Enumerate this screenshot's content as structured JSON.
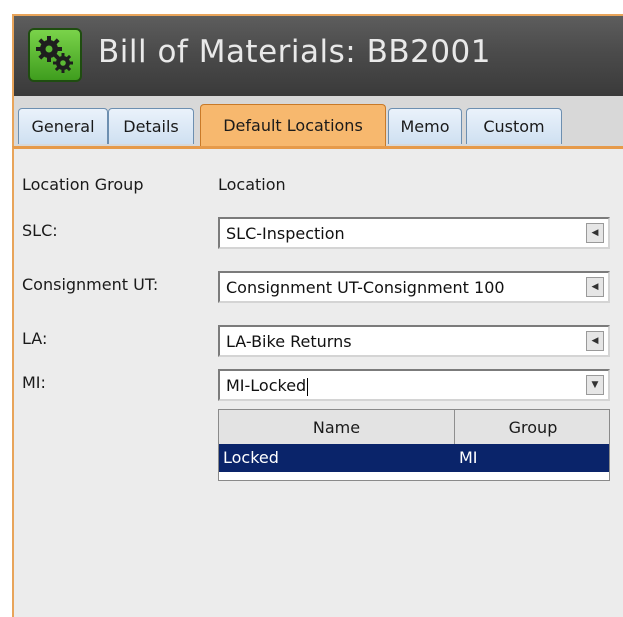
{
  "window": {
    "title": "Bill of Materials: BB2001",
    "icon": "gears-icon"
  },
  "tabs": [
    {
      "label": "General",
      "active": false
    },
    {
      "label": "Details",
      "active": false
    },
    {
      "label": "Default Locations",
      "active": true
    },
    {
      "label": "Memo",
      "active": false
    },
    {
      "label": "Custom",
      "active": false
    }
  ],
  "panel": {
    "col_headers": {
      "group": "Location Group",
      "location": "Location"
    },
    "rows": [
      {
        "label": "SLC:",
        "value": "SLC-Inspection",
        "button": "scroll-left-icon"
      },
      {
        "label": "Consignment UT:",
        "value": "Consignment UT-Consignment 100",
        "button": "scroll-left-icon"
      },
      {
        "label": "LA:",
        "value": "LA-Bike Returns",
        "button": "scroll-left-icon"
      },
      {
        "label": "MI:",
        "value": "MI-Locked",
        "button": "dropdown-arrow-icon"
      }
    ],
    "dropdown": {
      "columns": [
        "Name",
        "Group"
      ],
      "rows": [
        {
          "name": "Locked",
          "group": "MI",
          "selected": true
        }
      ]
    }
  },
  "colors": {
    "accent_orange": "#f7b86e",
    "selection": "#0a246a",
    "titlebar": "#4b4b4b"
  }
}
